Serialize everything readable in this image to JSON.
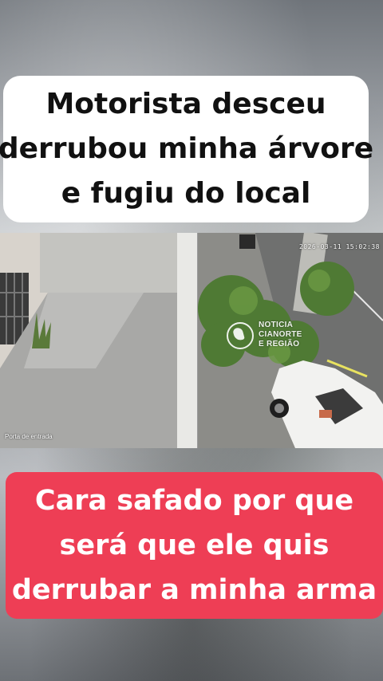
{
  "top_caption": {
    "line1": "Motorista desceu",
    "line2": "derrubou minha árvore",
    "line3": "e fugiu do local"
  },
  "video": {
    "timestamp": "2026-03-11 15:02:38",
    "camera_label": "Porta de entrada",
    "watermark": {
      "icon": "globe-map-icon",
      "line1": "NOTICIA",
      "line2": "CIANORTE",
      "line3": "E REGIÃO"
    }
  },
  "bottom_caption": {
    "line1": "Cara safado por que",
    "line2": "será que ele quis",
    "line3": "derrubar a minha arma"
  },
  "colors": {
    "top_caption_bg": "#ffffff",
    "top_caption_text": "#111111",
    "bottom_caption_bg": "#ee3e55",
    "bottom_caption_text": "#ffffff"
  }
}
